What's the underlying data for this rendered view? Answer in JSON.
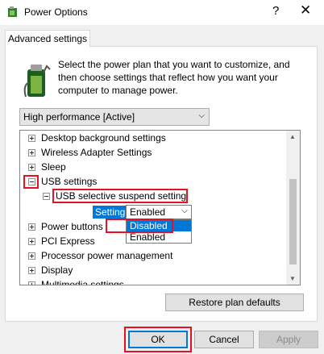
{
  "window": {
    "title": "Power Options",
    "help": "?",
    "close": "✕"
  },
  "tab": {
    "label": "Advanced settings"
  },
  "description": "Select the power plan that you want to customize, and then choose settings that reflect how you want your computer to manage power.",
  "plan_select": {
    "value": "High performance [Active]"
  },
  "tree": {
    "items": [
      {
        "label": "Desktop background settings",
        "expanded": false
      },
      {
        "label": "Wireless Adapter Settings",
        "expanded": false
      },
      {
        "label": "Sleep",
        "expanded": false
      },
      {
        "label": "USB settings",
        "expanded": true
      },
      {
        "label": "USB selective suspend setting",
        "expanded": true
      },
      {
        "label": "Power buttons",
        "expanded": false
      },
      {
        "label": "PCI Express",
        "expanded": false
      },
      {
        "label": "Processor power management",
        "expanded": false
      },
      {
        "label": "Display",
        "expanded": false
      },
      {
        "label": "Multimedia settings",
        "expanded": false
      }
    ],
    "setting_label": "Setting:",
    "setting_value": "Enabled",
    "options": [
      "Disabled",
      "Enabled"
    ],
    "highlighted_option": "Disabled"
  },
  "buttons": {
    "restore": "Restore plan defaults",
    "ok": "OK",
    "cancel": "Cancel",
    "apply": "Apply"
  },
  "colors": {
    "accent": "#0078d7",
    "highlight_box": "#e81123"
  }
}
